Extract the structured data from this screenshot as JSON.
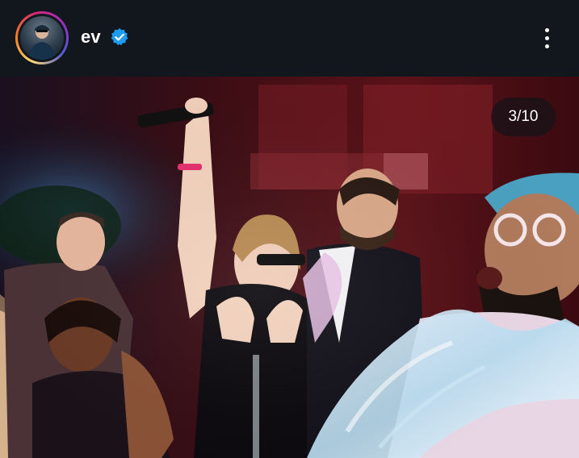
{
  "header": {
    "username": "ev",
    "verified_icon": "verified-badge-icon",
    "more_icon": "more-vertical-icon"
  },
  "post": {
    "carousel_counter": "3/10",
    "image_description_icon": "party-photo"
  },
  "colors": {
    "header_bg": "#12161d",
    "verified_blue": "#1d9bf0",
    "story_ring": [
      "#feda75",
      "#fa7e1e",
      "#d62976",
      "#962fbf",
      "#4f5bd5"
    ]
  }
}
